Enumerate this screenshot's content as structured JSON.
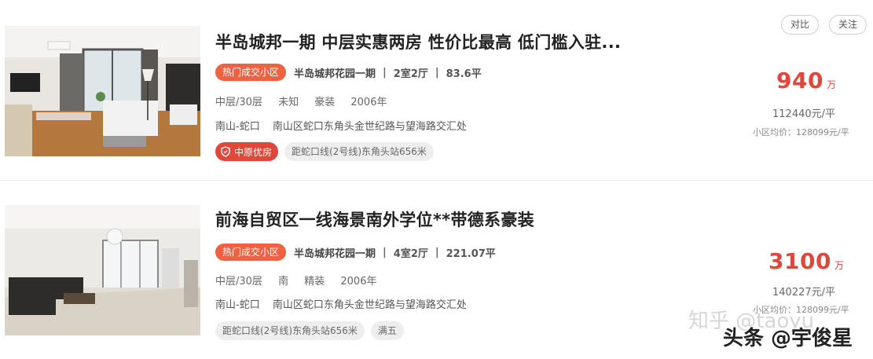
{
  "actions": {
    "compare_label": "对比",
    "follow_label": "关注"
  },
  "listings": [
    {
      "title": "半岛城邦一期 中层实惠两房 性价比最高 低门槛入驻...",
      "hot_tag": "热门成交小区",
      "community": "半岛城邦花园一期",
      "layout": "2室2厅",
      "area": "83.6平",
      "floor": "中层/30层",
      "orientation": "未知",
      "decoration": "豪装",
      "year": "2006年",
      "district": "南山-蛇口",
      "address": "南山区蛇口东角头金世纪路与望海路交汇处",
      "badge": "中原优房",
      "tags": [
        "距蛇口线(2号线)东角头站656米"
      ],
      "total_price": "940",
      "total_unit": "万",
      "unit_price": "112440元/平",
      "avg_price": "小区均价：128099元/平"
    },
    {
      "title": "前海自贸区一线海景南外学位**带德系豪装",
      "hot_tag": "热门成交小区",
      "community": "半岛城邦花园一期",
      "layout": "4室2厅",
      "area": "221.07平",
      "floor": "中层/30层",
      "orientation": "南",
      "decoration": "精装",
      "year": "2006年",
      "district": "南山-蛇口",
      "address": "南山区蛇口东角头金世纪路与望海路交汇处",
      "tags": [
        "距蛇口线(2号线)东角头站656米",
        "满五"
      ],
      "total_price": "3100",
      "total_unit": "万",
      "unit_price": "140227元/平",
      "avg_price": "小区均价：128099元/平"
    }
  ],
  "separator": "|",
  "watermarks": {
    "zhihu": "知乎 @taoyu",
    "toutiao": "头条 @宇俊星"
  },
  "colors": {
    "accent_red": "#e0473a",
    "hot_tag": "#f06142",
    "pill_bg": "#eeeeee"
  }
}
